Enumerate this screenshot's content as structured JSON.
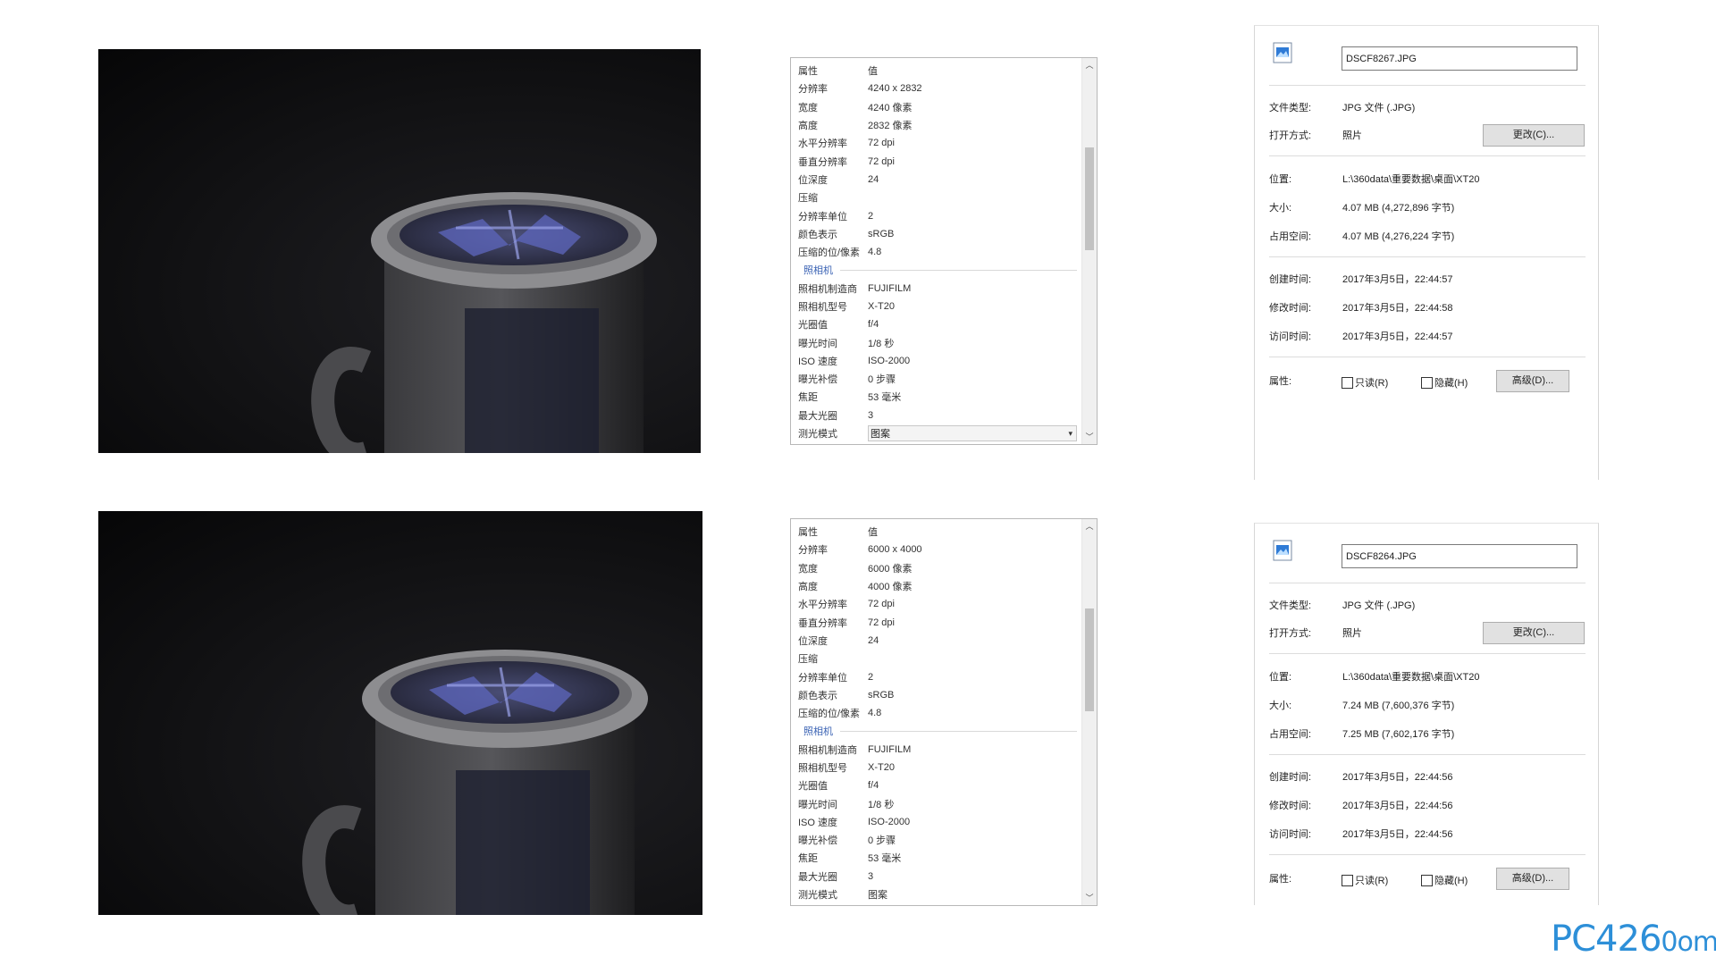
{
  "photos": [
    {
      "alt": "mug-photo-1"
    },
    {
      "alt": "mug-photo-2"
    }
  ],
  "details_header": {
    "key": "属性",
    "value": "值"
  },
  "details": [
    {
      "rows": [
        {
          "k": "分辨率",
          "v": "4240 x 2832"
        },
        {
          "k": "宽度",
          "v": "4240 像素"
        },
        {
          "k": "高度",
          "v": "2832 像素"
        },
        {
          "k": "水平分辨率",
          "v": "72 dpi"
        },
        {
          "k": "垂直分辨率",
          "v": "72 dpi"
        },
        {
          "k": "位深度",
          "v": "24"
        },
        {
          "k": "压缩",
          "v": ""
        },
        {
          "k": "分辨率单位",
          "v": "2"
        },
        {
          "k": "颜色表示",
          "v": "sRGB"
        },
        {
          "k": "压缩的位/像素",
          "v": "4.8"
        }
      ],
      "group": "照相机",
      "camera_rows": [
        {
          "k": "照相机制造商",
          "v": "FUJIFILM"
        },
        {
          "k": "照相机型号",
          "v": "X-T20"
        },
        {
          "k": "光圈值",
          "v": "f/4"
        },
        {
          "k": "曝光时间",
          "v": "1/8 秒"
        },
        {
          "k": "ISO 速度",
          "v": "ISO-2000"
        },
        {
          "k": "曝光补偿",
          "v": "0 步骤"
        },
        {
          "k": "焦距",
          "v": "53 毫米"
        },
        {
          "k": "最大光圈",
          "v": "3"
        }
      ],
      "last_row": {
        "k": "测光模式",
        "v": "图案"
      }
    },
    {
      "rows": [
        {
          "k": "分辨率",
          "v": "6000 x 4000"
        },
        {
          "k": "宽度",
          "v": "6000 像素"
        },
        {
          "k": "高度",
          "v": "4000 像素"
        },
        {
          "k": "水平分辨率",
          "v": "72 dpi"
        },
        {
          "k": "垂直分辨率",
          "v": "72 dpi"
        },
        {
          "k": "位深度",
          "v": "24"
        },
        {
          "k": "压缩",
          "v": ""
        },
        {
          "k": "分辨率单位",
          "v": "2"
        },
        {
          "k": "颜色表示",
          "v": "sRGB"
        },
        {
          "k": "压缩的位/像素",
          "v": "4.8"
        }
      ],
      "group": "照相机",
      "camera_rows": [
        {
          "k": "照相机制造商",
          "v": "FUJIFILM"
        },
        {
          "k": "照相机型号",
          "v": "X-T20"
        },
        {
          "k": "光圈值",
          "v": "f/4"
        },
        {
          "k": "曝光时间",
          "v": "1/8 秒"
        },
        {
          "k": "ISO 速度",
          "v": "ISO-2000"
        },
        {
          "k": "曝光补偿",
          "v": "0 步骤"
        },
        {
          "k": "焦距",
          "v": "53 毫米"
        },
        {
          "k": "最大光圈",
          "v": "3"
        }
      ],
      "last_row": {
        "k": "测光模式",
        "v": "图案"
      }
    }
  ],
  "labels": {
    "file_type": "文件类型:",
    "open_with": "打开方式:",
    "location": "位置:",
    "size": "大小:",
    "size_on_disk": "占用空间:",
    "created": "创建时间:",
    "modified": "修改时间:",
    "accessed": "访问时间:",
    "attributes": "属性:",
    "readonly": "只读(R)",
    "hidden": "隐藏(H)",
    "change_btn": "更改(C)...",
    "advanced_btn": "高级(D)..."
  },
  "dialogs": [
    {
      "filename": "DSCF8267.JPG",
      "file_type": "JPG 文件 (.JPG)",
      "open_with": "照片",
      "location": "L:\\360data\\重要数据\\桌面\\XT20",
      "size": "4.07 MB (4,272,896 字节)",
      "size_on_disk": "4.07 MB (4,276,224 字节)",
      "created": "2017年3月5日，22:44:57",
      "modified": "2017年3月5日，22:44:58",
      "accessed": "2017年3月5日，22:44:57"
    },
    {
      "filename": "DSCF8264.JPG",
      "file_type": "JPG 文件 (.JPG)",
      "open_with": "照片",
      "location": "L:\\360data\\重要数据\\桌面\\XT20",
      "size": "7.24 MB (7,600,376 字节)",
      "size_on_disk": "7.25 MB (7,602,176 字节)",
      "created": "2017年3月5日，22:44:56",
      "modified": "2017年3月5日，22:44:56",
      "accessed": "2017年3月5日，22:44:56"
    }
  ],
  "watermark": {
    "main": "PC426",
    "suffix": "0om"
  },
  "colors": {
    "group_label": "#3b63b4",
    "watermark": "#2d8fd8",
    "photo_bg": "#0a0a0b"
  }
}
